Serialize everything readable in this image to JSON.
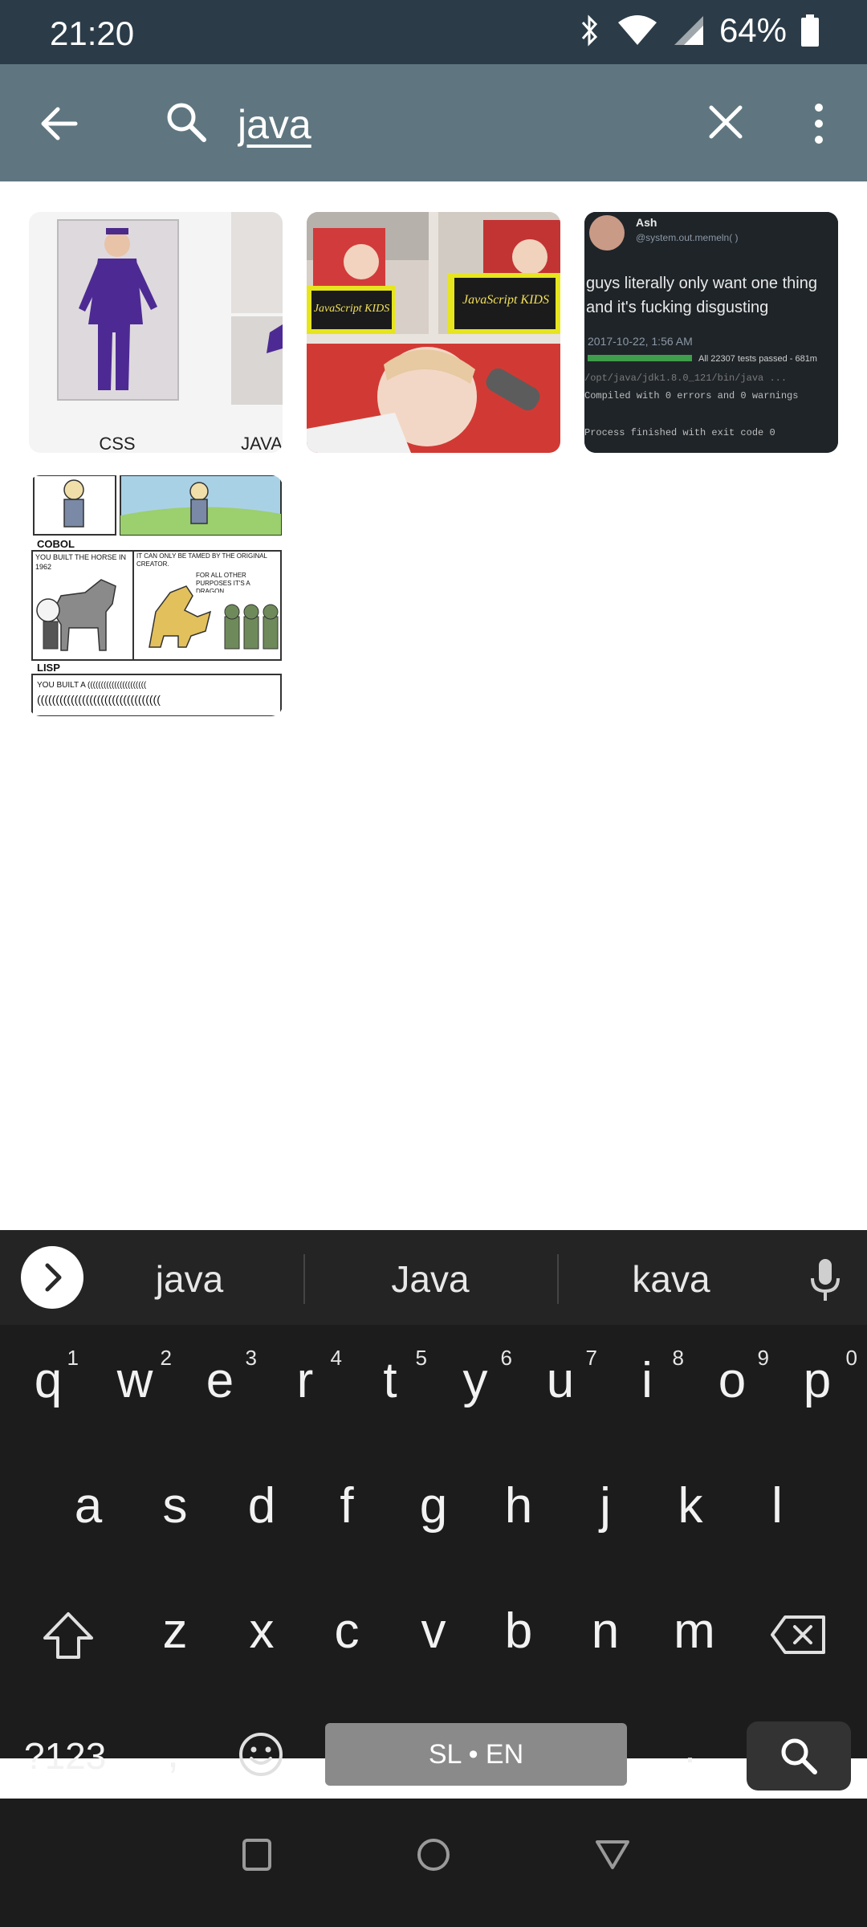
{
  "status_bar": {
    "time": "21:20",
    "battery_percent": "64%"
  },
  "search": {
    "query": "java"
  },
  "results": [
    {
      "labels": [
        "CSS",
        "JAVA"
      ]
    },
    {
      "labels": [
        "JavaScript KIDS",
        "JavaScript KIDS"
      ]
    },
    {
      "user": "Ash",
      "handle": "@system.out.memeln( )",
      "text": "guys literally only want one thing and it's fucking disgusting",
      "date": "2017-10-22, 1:56 AM",
      "tests": "All 22307 tests passed - 681m",
      "path": "/opt/java/jdk1.8.0_121/bin/java ...",
      "compiled": "Compiled with 0 errors and 0 warnings",
      "finished": "Process finished with exit code 0"
    },
    {
      "cobol": "COBOL",
      "cobol_caption": "YOU BUILT THE HORSE IN 1962",
      "dragon_caption": "IT CAN ONLY BE TAMED BY THE ORIGINAL CREATOR.",
      "dragon_caption2": "FOR ALL OTHER PURPOSES IT'S A DRAGON.",
      "lisp": "LISP",
      "lisp_caption": "YOU BUILT A ((((((((((((((((((((((",
      "lisp_caption2": "((((((((((((((((((((((((((((((((("
    }
  ],
  "keyboard": {
    "suggestions": [
      "java",
      "Java",
      "kava"
    ],
    "row1": [
      "q",
      "w",
      "e",
      "r",
      "t",
      "y",
      "u",
      "i",
      "o",
      "p"
    ],
    "row1_hints": [
      "1",
      "2",
      "3",
      "4",
      "5",
      "6",
      "7",
      "8",
      "9",
      "0"
    ],
    "row2": [
      "a",
      "s",
      "d",
      "f",
      "g",
      "h",
      "j",
      "k",
      "l"
    ],
    "row3": [
      "z",
      "x",
      "c",
      "v",
      "b",
      "n",
      "m"
    ],
    "symbols_label": "?123",
    "comma": ",",
    "space_label": "SL • EN",
    "period": "."
  },
  "colors": {
    "status_bar": "#2b3c48",
    "toolbar": "#5f7680",
    "keyboard": "#1c1c1c"
  }
}
